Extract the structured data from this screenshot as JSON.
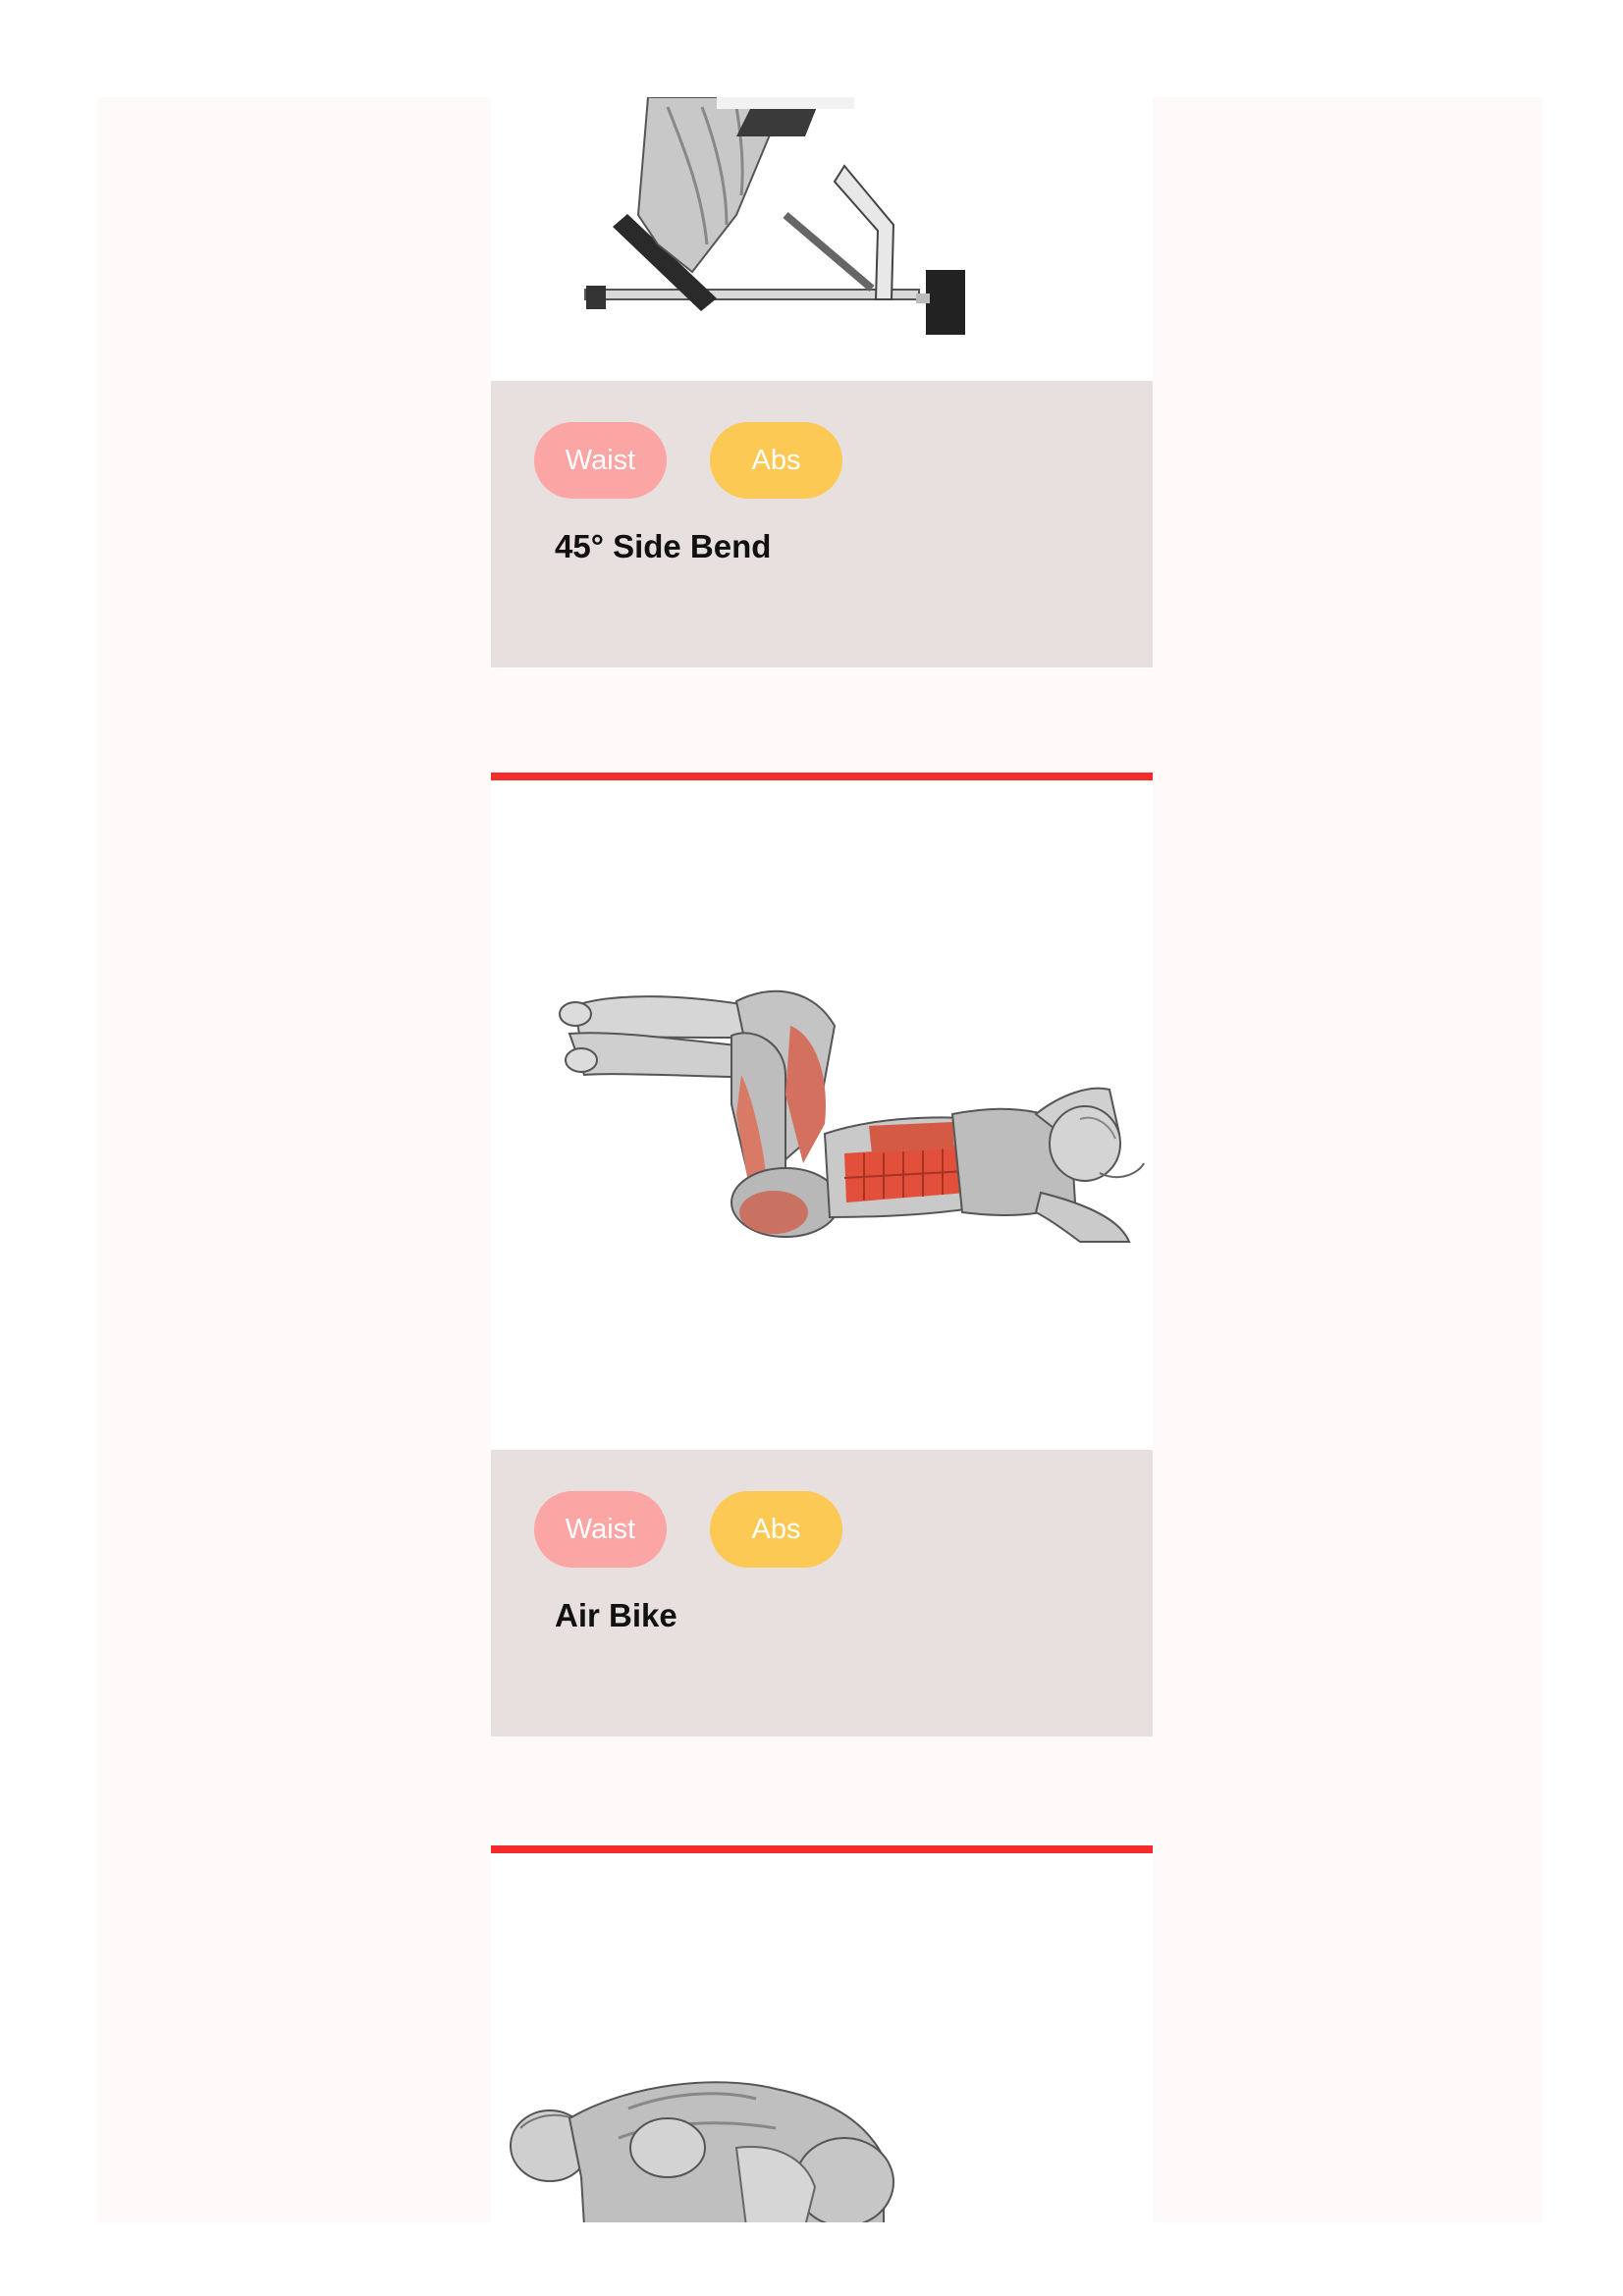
{
  "exercises": [
    {
      "name": "45° Side Bend",
      "tags": [
        "Waist",
        "Abs"
      ],
      "image_icon": "hyperextension-bench-illustration-icon"
    },
    {
      "name": "Air Bike",
      "tags": [
        "Waist",
        "Abs"
      ],
      "image_icon": "air-bike-crunch-illustration-icon"
    },
    {
      "image_icon": "kneeling-figure-illustration-icon"
    }
  ],
  "colors": {
    "accent": "#f52a2a",
    "tag_waist": "#fca5a5",
    "tag_abs": "#fcc955",
    "info_panel": "#e8dfdf",
    "page_background": "#fffafa",
    "highlighted_muscle": "#e2503c"
  }
}
